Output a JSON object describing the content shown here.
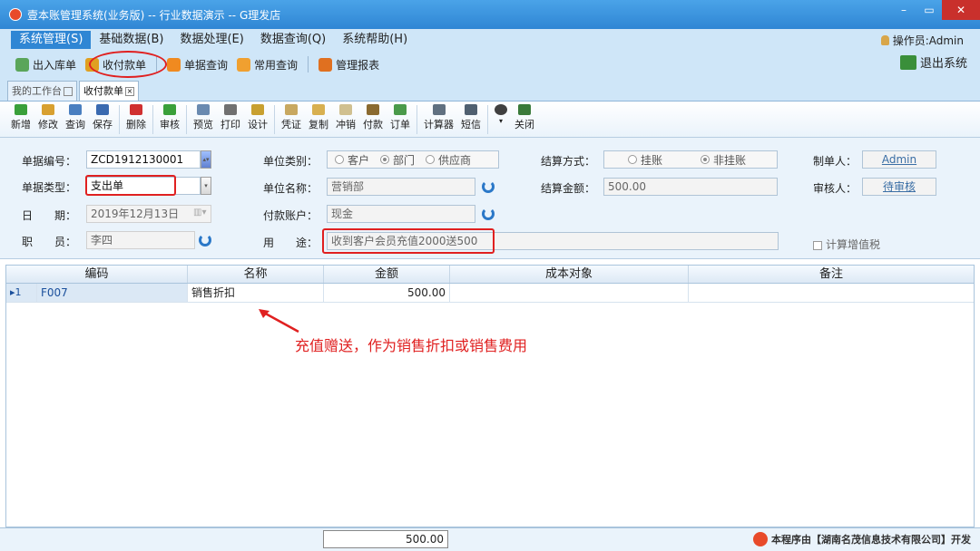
{
  "window": {
    "title": "壹本账管理系统(业务版) -- 行业数据演示 -- G理发店",
    "minimize": "–",
    "maximize": "▭",
    "close": "✕"
  },
  "menubar": {
    "items": [
      "系统管理(S)",
      "基础数据(B)",
      "数据处理(E)",
      "数据查询(Q)",
      "系统帮助(H)"
    ],
    "operator": "操作员:Admin"
  },
  "quickbar": {
    "items": [
      "出入库单",
      "收付款单",
      "单据查询",
      "常用查询",
      "管理报表"
    ],
    "exit": "退出系统"
  },
  "tabs": [
    "我的工作台",
    "收付款单"
  ],
  "toolbar": {
    "buttons": [
      "新增",
      "修改",
      "查询",
      "保存",
      "删除",
      "审核",
      "预览",
      "打印",
      "设计",
      "凭证",
      "复制",
      "冲销",
      "付款",
      "订单",
      "计算器",
      "短信",
      "关闭"
    ]
  },
  "form": {
    "doc_no_label": "单据编号：",
    "doc_no": "ZCD1912130001",
    "doc_type_label": "单据类型：",
    "doc_type": "支出单",
    "date_label": "日　　期：",
    "date": "2019年12月13日",
    "staff_label": "职　　员：",
    "staff": "李四",
    "unit_type_label": "单位类别：",
    "unit_types": [
      "客户",
      "部门",
      "供应商"
    ],
    "unit_name_label": "单位名称：",
    "unit_name": "营销部",
    "account_label": "付款账户：",
    "account": "现金",
    "purpose_label": "用　　途：",
    "purpose": "收到客户会员充值2000送500",
    "settle_method_label": "结算方式：",
    "settle_methods": [
      "挂账",
      "非挂账"
    ],
    "settle_amount_label": "结算金额：",
    "settle_amount": "500.00",
    "maker_label": "制单人：",
    "maker": "Admin",
    "auditor_label": "审核人：",
    "auditor": "待审核",
    "vat_label": "计算增值税"
  },
  "grid": {
    "columns": [
      "编码",
      "名称",
      "金额",
      "成本对象",
      "备注"
    ],
    "rows": [
      {
        "idx": "1",
        "code": "F007",
        "name": "销售折扣",
        "amount": "500.00",
        "cost": "",
        "note": ""
      }
    ],
    "total": "500.00"
  },
  "annotation": "充值赠送，作为销售折扣或销售费用",
  "brand": "本程序由【湖南名茂信息技术有限公司】开发",
  "colors": {
    "titlebar": "#2f86d4",
    "highlight": "#e02020",
    "panel": "#eaf3fb"
  }
}
